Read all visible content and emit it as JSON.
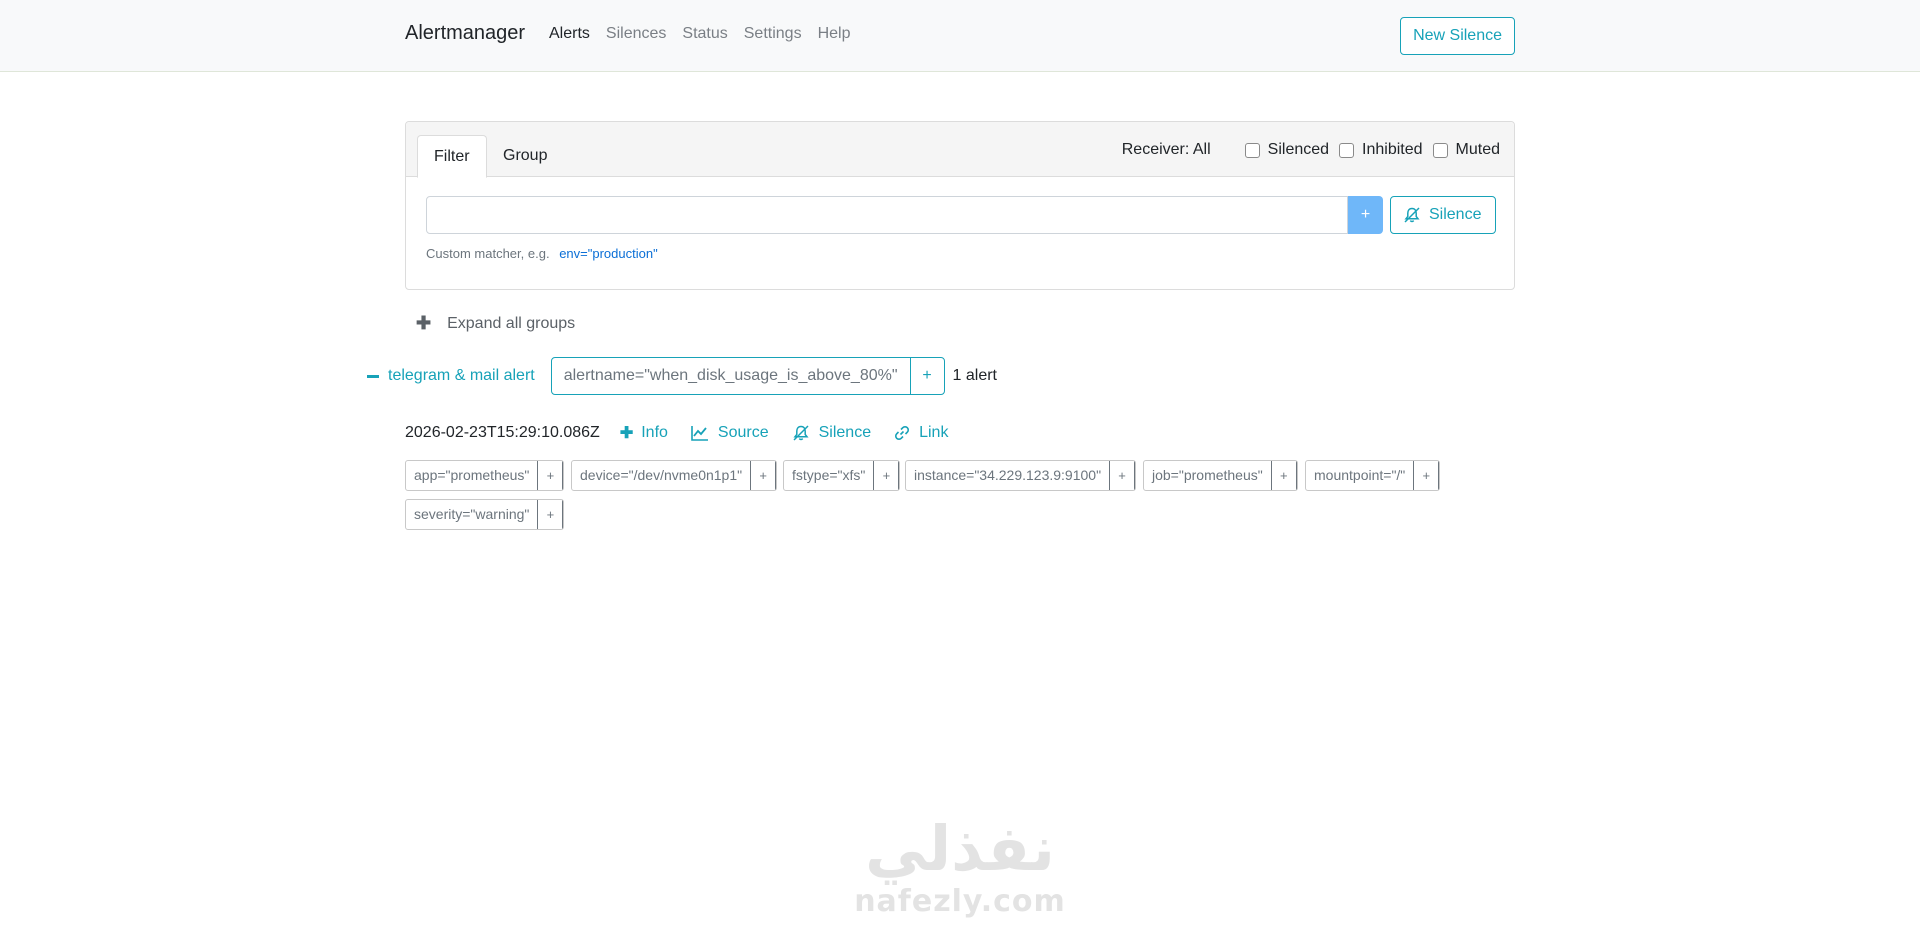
{
  "navbar": {
    "brand": "Alertmanager",
    "links": [
      "Alerts",
      "Silences",
      "Status",
      "Settings",
      "Help"
    ],
    "new_silence": "New Silence"
  },
  "filter_card": {
    "tabs": [
      "Filter",
      "Group"
    ],
    "receiver": "Receiver: All",
    "checkboxes": [
      "Silenced",
      "Inhibited",
      "Muted"
    ],
    "input_value": "",
    "add_button": "+",
    "silence_button": "Silence",
    "hint_text": "Custom matcher, e.g.",
    "hint_example": "env=\"production\""
  },
  "expand_all": "Expand all groups",
  "group": {
    "name": "telegram & mail alert",
    "label": "alertname=\"when_disk_usage_is_above_80%\"",
    "plus": "+",
    "count": "1 alert"
  },
  "alert": {
    "timestamp": "2026-02-23T15:29:10.086Z",
    "actions": [
      "Info",
      "Source",
      "Silence",
      "Link"
    ],
    "labels": [
      "app=\"prometheus\"",
      "device=\"/dev/nvme0n1p1\"",
      "fstype=\"xfs\"",
      "instance=\"34.229.123.9:9100\"",
      "job=\"prometheus\"",
      "mountpoint=\"/\"",
      "severity=\"warning\""
    ],
    "chip_plus": "+"
  },
  "watermark": {
    "arabic": "نفذلي",
    "latin": "nafezly.com"
  },
  "colors": {
    "accent": "#17a2b8",
    "primary_button": "#6fb7f9",
    "link": "#0b6fd6"
  }
}
